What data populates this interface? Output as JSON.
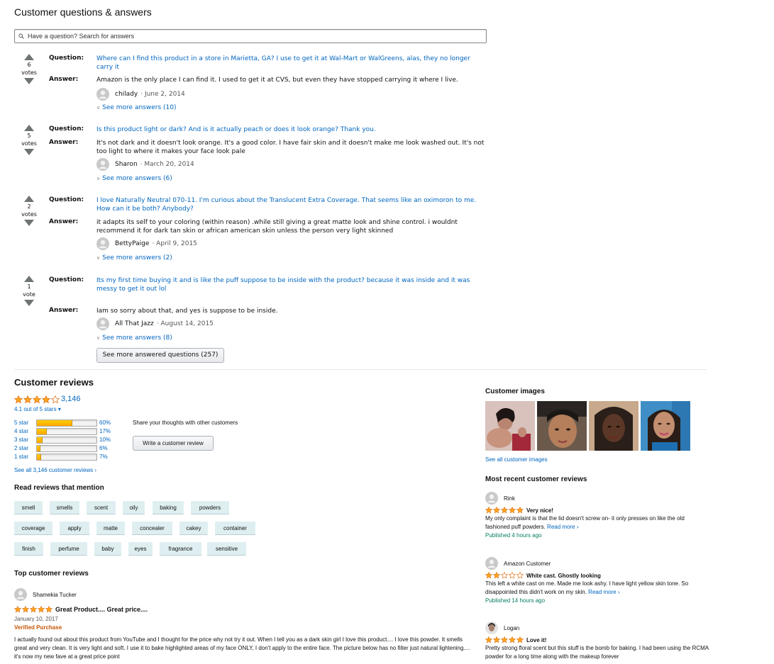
{
  "qa": {
    "title": "Customer questions & answers",
    "search_placeholder": "Have a question? Search for answers",
    "question_label": "Question:",
    "answer_label": "Answer:",
    "items": [
      {
        "votes": "6",
        "votes_label": "votes",
        "question": "Where can I find this product in a store in Marietta, GA? I use to get it at Wal-Mart or WalGreens, alas, they no longer carry it",
        "answer": "Amazon is the only place I can find it. I used to get it at CVS, but even they have stopped carrying it where I live.",
        "author": "chilady",
        "date": "· June 2, 2014",
        "see_more": "See more answers (10)"
      },
      {
        "votes": "5",
        "votes_label": "votes",
        "question": "Is this product light or dark? And is it actually peach or does it look orange? Thank you.",
        "answer": "It's not dark and it doesn't look orange. It's a good color. I have fair skin and it doesn't make me look washed out. It's not too light to where it makes your face look pale",
        "author": "Sharon",
        "date": "· March 20, 2014",
        "see_more": "See more answers (6)"
      },
      {
        "votes": "2",
        "votes_label": "votes",
        "question": "I love Naturally Neutral 070-11. I'm curious about the Translucent Extra Coverage. That seems like an oximoron to me. How can it be both? Anybody?",
        "answer": "it adapts its self to your coloring (within reason) .while still giving a great matte look and shine control. i wouldnt recommend it for dark tan skin or african american skin unless the person very light skinned",
        "author": "BettyPaige",
        "date": "· April 9, 2015",
        "see_more": "See more answers (2)"
      },
      {
        "votes": "1",
        "votes_label": "vote",
        "question": "Its my first time buying it and is like the puff suppose to be inside with the product? because it was inside and it was messy to get it out lol",
        "answer": "Iam so sorry about that, and yes is suppose to be inside.",
        "author": "All That Jazz",
        "date": "· August 14, 2015",
        "see_more": "See more answers (8)"
      }
    ],
    "more_button": "See more answered questions (257)"
  },
  "reviews": {
    "title": "Customer reviews",
    "rating": 4.1,
    "count": "3,146",
    "avg_text": "4.1 out of 5 stars ▾",
    "histogram": [
      {
        "label": "5 star",
        "pct": "60%",
        "value": 60
      },
      {
        "label": "4 star",
        "pct": "17%",
        "value": 17
      },
      {
        "label": "3 star",
        "pct": "10%",
        "value": 10
      },
      {
        "label": "2 star",
        "pct": "6%",
        "value": 6
      },
      {
        "label": "1 star",
        "pct": "7%",
        "value": 7
      }
    ],
    "share_text": "Share your thoughts with other customers",
    "write_button": "Write a customer review",
    "see_all": "See all 3,146 customer reviews ›",
    "mention_title": "Read reviews that mention",
    "tags": [
      "smell",
      "smells",
      "scent",
      "oily",
      "baking",
      "powders",
      "coverage",
      "apply",
      "matte",
      "concealer",
      "cakey",
      "container",
      "finish",
      "perfume",
      "baby",
      "eyes",
      "fragrance",
      "sensitive"
    ],
    "top_title": "Top customer reviews",
    "top_review": {
      "author": "Shamekia Tucker",
      "rating": 5,
      "headline": "Great Product.... Great price....",
      "date": "January 10, 2017",
      "verified": "Verified Purchase",
      "body": "I actually found out about this product from YouTube and I thought for the price why not try it out. When I tell you as a dark skin girl I love this product.... I love this powder. It smells great and very clean. It is very light and soft. I use it to bake highlighted areas of my face ONLY, I don't apply to the entire face. The picture below has no filter just natural lightening.... it's now my new fave at a great price point"
    }
  },
  "right": {
    "images_title": "Customer images",
    "see_all_images": "See all customer images",
    "recent_title": "Most recent customer reviews",
    "recent": [
      {
        "author": "Rink",
        "rating": 5,
        "headline": "Very nice!",
        "body": "My only complaint is that the lid doesn't screw on- it only presses on like the old fashioned puff powders.",
        "read_more": "Read more ›",
        "published": "Published 4 hours ago"
      },
      {
        "author": "Amazon Customer",
        "rating": 2,
        "headline": "White cast. Ghostly looking",
        "body": "This left a white cast on me. Made me look ashy. I have light yellow skin tone. So disappointed this didn't work on my skin.",
        "read_more": "Read more ›",
        "published": "Published 14 hours ago"
      },
      {
        "author": "Logan",
        "rating": 5,
        "headline": "Love it!",
        "body": "Pretty strong floral scent but this stuff is the bomb for baking. I had been using the RCMA powder for a long time along with the makeup forever",
        "read_more": "",
        "published": ""
      }
    ]
  },
  "colors": {
    "link": "#0066c0",
    "star": "#ffa41c",
    "verified": "#c45500",
    "published": "#067d62",
    "tag_bg": "#dfeff1"
  }
}
